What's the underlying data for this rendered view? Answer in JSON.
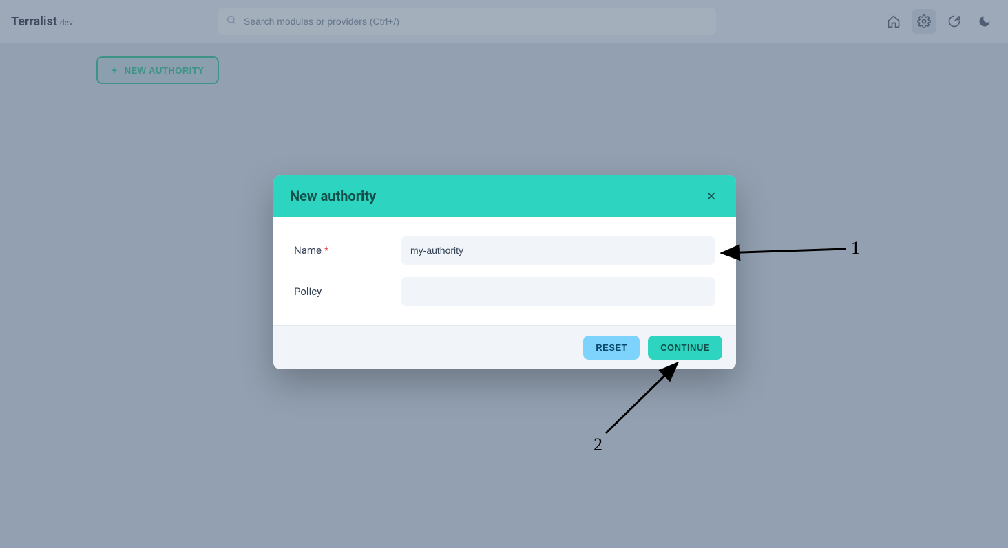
{
  "header": {
    "brand": "Terralist",
    "brand_sub": "dev",
    "search_placeholder": "Search modules or providers (Ctrl+/)"
  },
  "toolbar": {
    "new_authority_label": "NEW AUTHORITY"
  },
  "modal": {
    "title": "New authority",
    "fields": {
      "name_label": "Name",
      "name_value": "my-authority",
      "policy_label": "Policy",
      "policy_value": ""
    },
    "buttons": {
      "reset": "RESET",
      "continue": "CONTINUE"
    }
  },
  "annotations": {
    "a1": "1",
    "a2": "2"
  }
}
